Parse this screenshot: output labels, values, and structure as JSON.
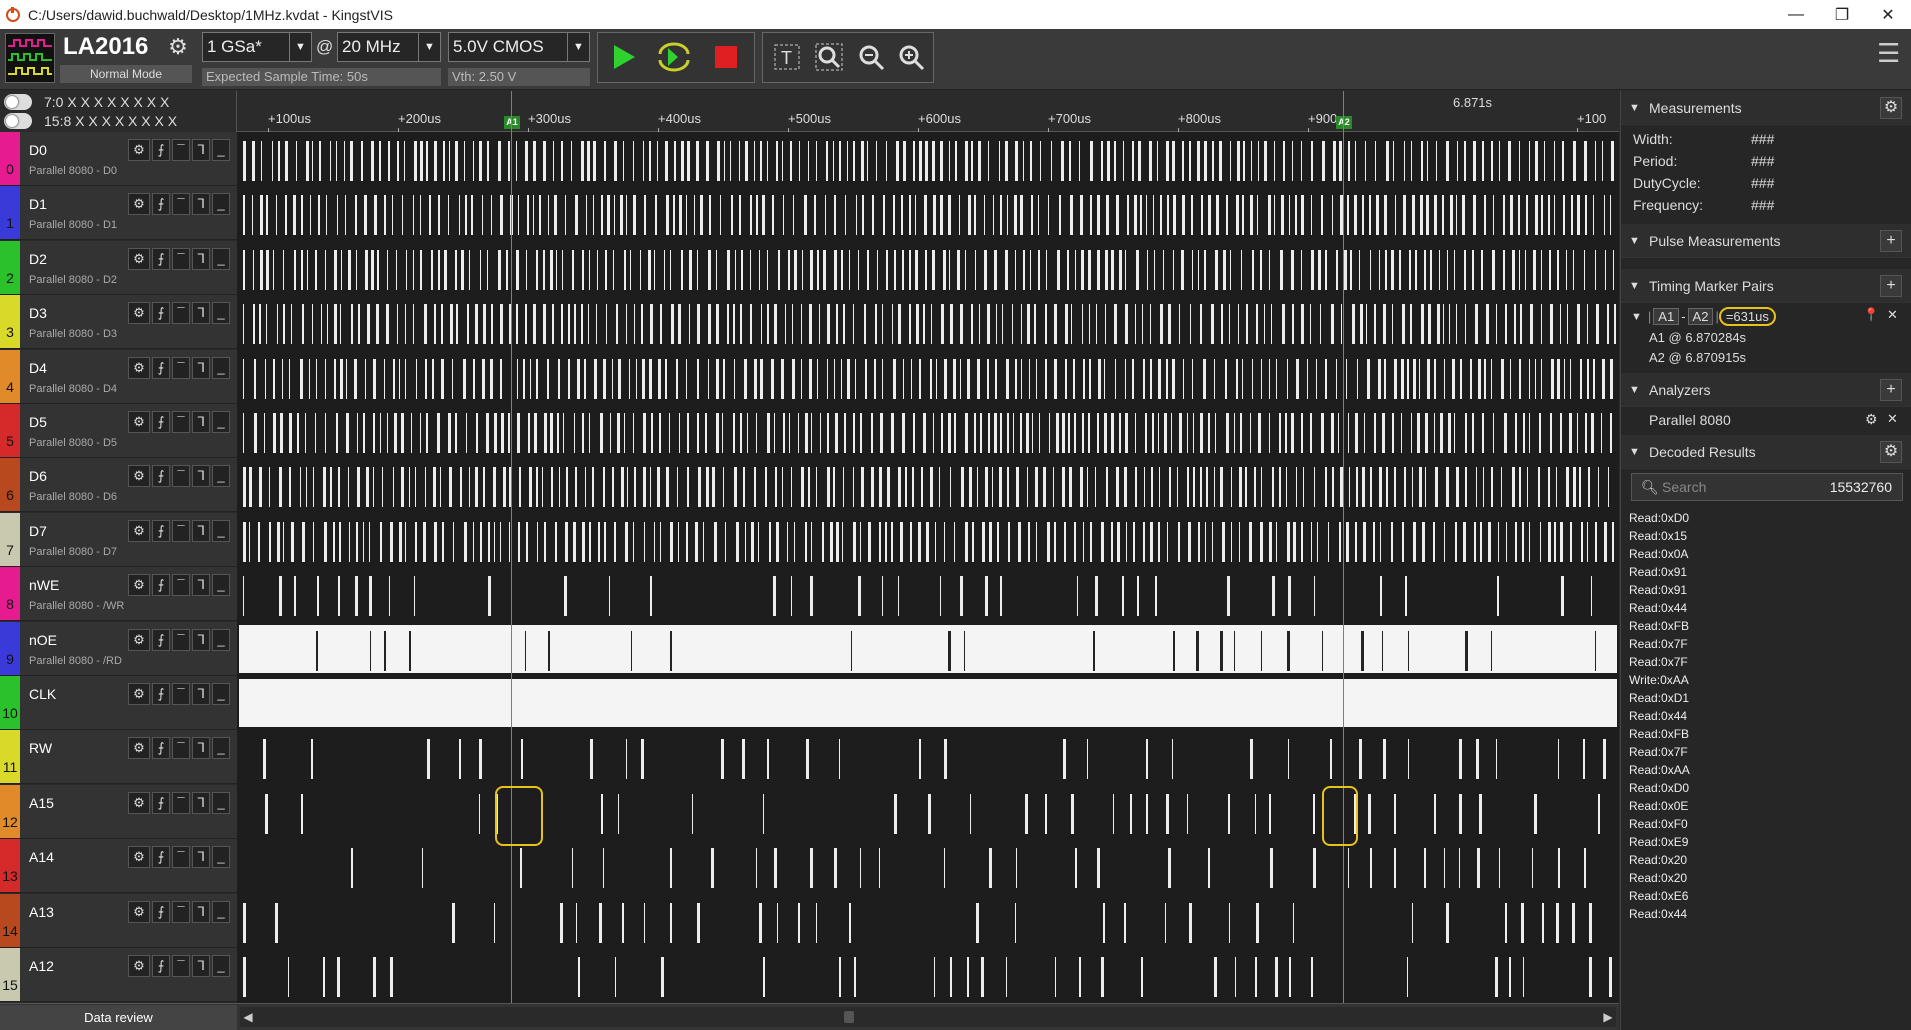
{
  "window": {
    "title": "C:/Users/dawid.buchwald/Desktop/1MHz.kvdat - KingstVIS",
    "min": "—",
    "max": "❐",
    "close": "✕"
  },
  "device": {
    "name": "LA2016",
    "mode": "Normal Mode"
  },
  "toolbar": {
    "sample_depth": "1 GSa*",
    "at": "@",
    "sample_rate": "20 MHz",
    "threshold": "5.0V CMOS",
    "expected_time": "Expected Sample Time: 50s",
    "vth": "Vth: 2.50 V",
    "run_icon": "play-icon",
    "repeat_icon": "repeat-icon",
    "stop_icon": "stop-icon",
    "text_tool_icon": "text-icon",
    "zoom_fit_icon": "zoom-fit-icon",
    "zoom_out_icon": "zoom-out-icon",
    "zoom_in_icon": "zoom-in-icon",
    "menu_icon": "hamburger-icon"
  },
  "groups": [
    {
      "label": "7:0 X X X X X X X X"
    },
    {
      "label": "15:8 X X X X X X X X"
    }
  ],
  "ruler": {
    "ticks": [
      "+100us",
      "+200us",
      "+300us",
      "+400us",
      "+500us",
      "+600us",
      "+700us",
      "+800us",
      "+900us",
      "+100"
    ],
    "center_time": "6.871s",
    "marker1": "A1",
    "marker2": "A2"
  },
  "channels": [
    {
      "num": "0",
      "name": "D0",
      "analyzer": "Parallel 8080 - D0",
      "color": "#e51b8f"
    },
    {
      "num": "1",
      "name": "D1",
      "analyzer": "Parallel 8080 - D1",
      "color": "#3a3ad8"
    },
    {
      "num": "2",
      "name": "D2",
      "analyzer": "Parallel 8080 - D2",
      "color": "#2ac12a"
    },
    {
      "num": "3",
      "name": "D3",
      "analyzer": "Parallel 8080 - D3",
      "color": "#d9d92a"
    },
    {
      "num": "4",
      "name": "D4",
      "analyzer": "Parallel 8080 - D4",
      "color": "#e08a2a"
    },
    {
      "num": "5",
      "name": "D5",
      "analyzer": "Parallel 8080 - D5",
      "color": "#d42a2a"
    },
    {
      "num": "6",
      "name": "D6",
      "analyzer": "Parallel 8080 - D6",
      "color": "#b8481e"
    },
    {
      "num": "7",
      "name": "D7",
      "analyzer": "Parallel 8080 - D7",
      "color": "#c9c9b0"
    },
    {
      "num": "8",
      "name": "nWE",
      "analyzer": "Parallel 8080 - /WR",
      "color": "#e51b8f"
    },
    {
      "num": "9",
      "name": "nOE",
      "analyzer": "Parallel 8080 - /RD",
      "color": "#3a3ad8"
    },
    {
      "num": "10",
      "name": "CLK",
      "analyzer": "",
      "color": "#2ac12a"
    },
    {
      "num": "11",
      "name": "RW",
      "analyzer": "",
      "color": "#d9d92a"
    },
    {
      "num": "12",
      "name": "A15",
      "analyzer": "",
      "color": "#e08a2a"
    },
    {
      "num": "13",
      "name": "A14",
      "analyzer": "",
      "color": "#d42a2a"
    },
    {
      "num": "14",
      "name": "A13",
      "analyzer": "",
      "color": "#b8481e"
    },
    {
      "num": "15",
      "name": "A12",
      "analyzer": "",
      "color": "#c9c9b0"
    }
  ],
  "channel_controls": {
    "gear": "⚙",
    "rise": "⨍",
    "high": "¯",
    "fall": "ᒣ",
    "low": "_"
  },
  "bottom": {
    "data_review": "Data review"
  },
  "panel": {
    "measurements": {
      "title": "Measurements",
      "rows": [
        {
          "label": "Width:",
          "value": "###"
        },
        {
          "label": "Period:",
          "value": "###"
        },
        {
          "label": "DutyCycle:",
          "value": "###"
        },
        {
          "label": "Frequency:",
          "value": "###"
        }
      ]
    },
    "pulse": {
      "title": "Pulse Measurements"
    },
    "timing": {
      "title": "Timing Marker Pairs",
      "a1": "A1",
      "dash": "-",
      "a2": "A2",
      "delta": "=631us",
      "a1_at": "A1 @ 6.870284s",
      "a2_at": "A2 @ 6.870915s"
    },
    "analyzers": {
      "title": "Analyzers",
      "item": "Parallel 8080"
    },
    "decoded": {
      "title": "Decoded Results",
      "search_placeholder": "Search",
      "count": "15532760",
      "rows": [
        "Read:0xD0",
        "Read:0x15",
        "Read:0x0A",
        "Read:0x91",
        "Read:0x91",
        "Read:0x44",
        "Read:0xFB",
        "Read:0x7F",
        "Read:0x7F",
        "Write:0xAA",
        "Read:0xD1",
        "Read:0x44",
        "Read:0xFB",
        "Read:0x7F",
        "Read:0xAA",
        "Read:0xD0",
        "Read:0x0E",
        "Read:0xF0",
        "Read:0xE9",
        "Read:0x20",
        "Read:0x20",
        "Read:0xE6",
        "Read:0x44"
      ]
    }
  }
}
